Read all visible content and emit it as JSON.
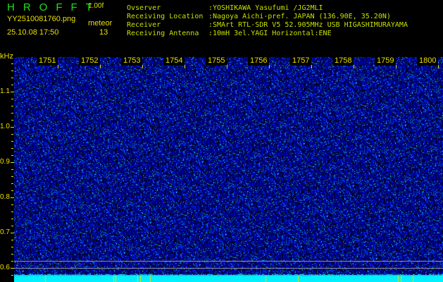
{
  "header": {
    "app": "HROFFT",
    "version": "1.00f",
    "filename": "YY2510081760.png",
    "datetime": "25.10.08 17:50",
    "meteor_label": "meteor",
    "meteor_count": "13"
  },
  "info": [
    {
      "label": "Ovserver",
      "value": ":YOSHIKAWA Yasufumi /JG2MLI"
    },
    {
      "label": "Receiving Location",
      "value": ":Nagoya Aichi-pref. JAPAN (136.90E, 35.20N)"
    },
    {
      "label": "Receiver",
      "value": ":SMArt RTL-SDR V5 52.905MHz USB HIGASHIMURAYAMA"
    },
    {
      "label": "Receiving Antenna",
      "value": ":10mH 3el.YAGI Horizontal:ENE"
    }
  ],
  "axis": {
    "unit": "kHz",
    "y_labels": [
      "1.1",
      "1.0",
      "0.9",
      "0.8",
      "0.7",
      "0.6"
    ],
    "time_labels": [
      "1751",
      "1752",
      "1753",
      "1754",
      "1755",
      "1756",
      "1757",
      "1758",
      "1759",
      "1800"
    ]
  },
  "colors": {
    "background": "#000000",
    "noise": "#1030c0",
    "bottom_bar": "#00f0ff",
    "text": "#e8e000"
  }
}
